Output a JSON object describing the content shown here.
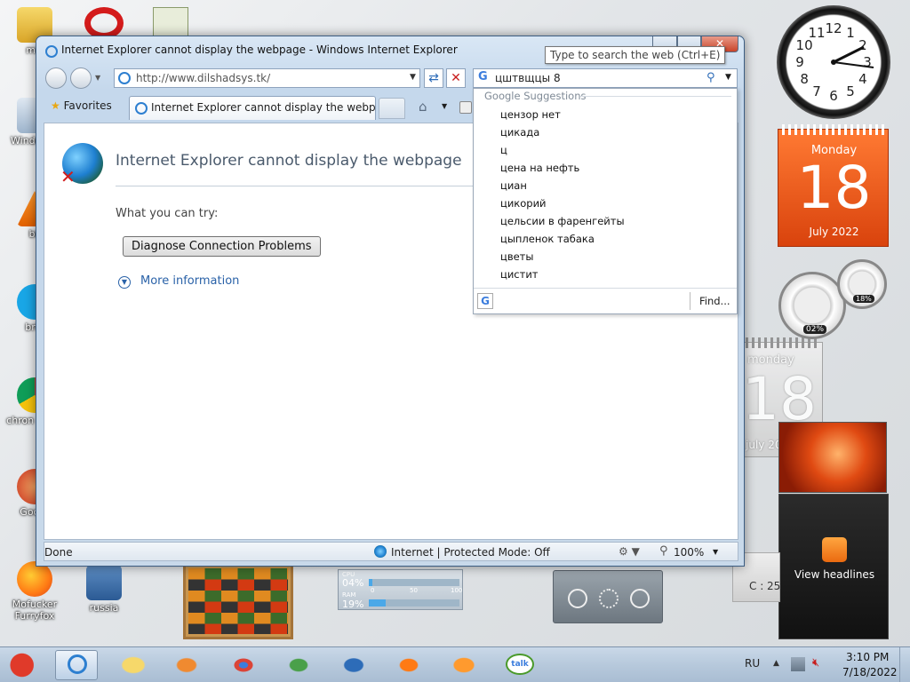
{
  "desktop": {
    "left_icons": [
      {
        "label": "mis",
        "icon": "folder-icon"
      },
      {
        "label": "Windo Vis",
        "icon": "recycle-bin-icon"
      },
      {
        "label": "bil",
        "icon": "vlc-icon"
      },
      {
        "label": "brib",
        "icon": "skype-icon"
      },
      {
        "label": "chron feces",
        "icon": "chrome-icon"
      },
      {
        "label": "Gocks",
        "icon": "browser-icon"
      },
      {
        "label": "Mofucker Furryfox",
        "icon": "firefox-icon"
      },
      {
        "label": "russia",
        "icon": "castle-icon"
      }
    ]
  },
  "window": {
    "title": "Internet Explorer cannot display the webpage - Windows Internet Explorer",
    "address": "http://www.dilshadsys.tk/",
    "search_value": "цштвщцы 8",
    "search_tooltip": "Type to search the web (Ctrl+E)",
    "favorites_label": "Favorites",
    "tab_title": "Internet Explorer cannot display the webpage"
  },
  "page": {
    "heading": "Internet Explorer cannot display the webpage",
    "try_label": "What you can try:",
    "diagnose_button": "Diagnose Connection Problems",
    "more_info": "More information"
  },
  "suggestions": {
    "header": "Google Suggestions",
    "items": [
      "цензор нет",
      "цикада",
      "ц",
      "цена на нефть",
      "циан",
      "цикорий",
      "цельсии в фаренгейты",
      "цыпленок табака",
      "цветы",
      "цистит"
    ],
    "find_label": "Find..."
  },
  "status": {
    "text": "Done",
    "zone": "Internet | Protected Mode: Off",
    "zoom": "100%"
  },
  "gadgets": {
    "calendar_day": "Monday",
    "calendar_date": "18",
    "calendar_month": "July 2022",
    "calendar2_day": "monday",
    "calendar2_date": "18",
    "calendar2_month": "july 2022",
    "cpu_gauge": "02%",
    "ram_gauge": "18%",
    "cpu_label": "CPU",
    "cpu_value": "04%",
    "ram_label": "RAM",
    "ram_value": "19%",
    "meter_scale": [
      "0",
      "50",
      "100"
    ],
    "drive_label": "C : 25",
    "headlines": "View headlines",
    "clock_numbers": [
      "12",
      "1",
      "2",
      "3",
      "4",
      "5",
      "6",
      "7",
      "8",
      "9",
      "10",
      "11"
    ]
  },
  "taskbar": {
    "language": "RU",
    "time": "3:10 PM",
    "date": "7/18/2022",
    "talk_label": "talk"
  },
  "colors": {
    "calendar_orange": "#e8581a",
    "link_blue": "#2a62a8",
    "heading_color": "#4a5a6c"
  }
}
